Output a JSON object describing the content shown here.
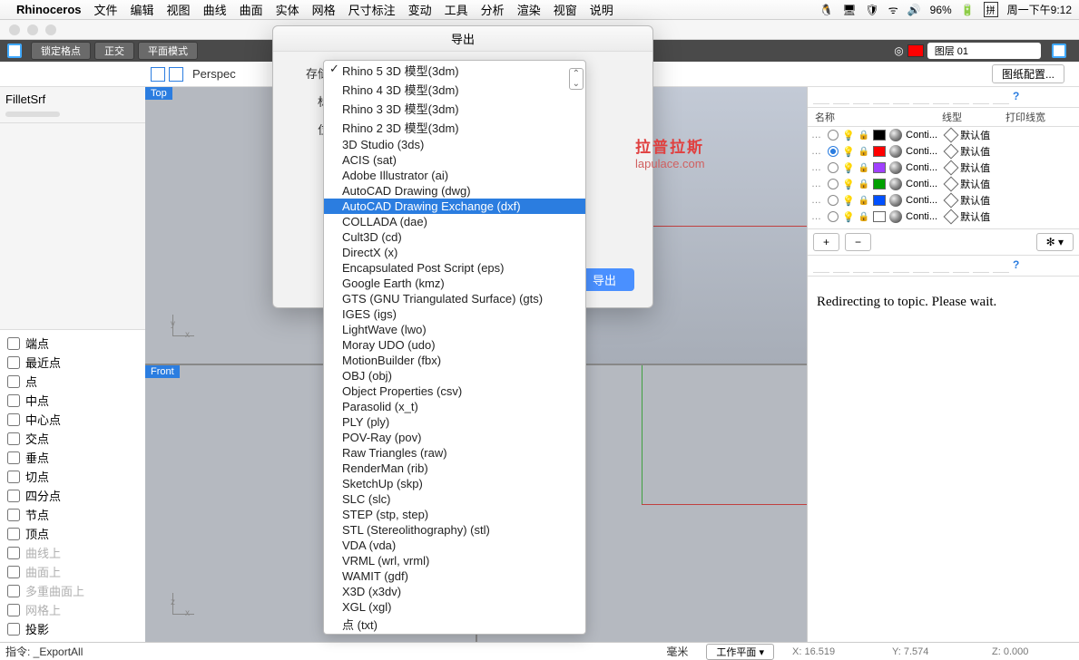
{
  "menubar": {
    "app": "Rhinoceros",
    "items": [
      "文件",
      "编辑",
      "视图",
      "曲线",
      "曲面",
      "实体",
      "网格",
      "尺寸标注",
      "变动",
      "工具",
      "分析",
      "渲染",
      "视窗",
      "说明"
    ],
    "battery": "96%",
    "ime": "拼",
    "clock": "周一下午9:12"
  },
  "toolbar": {
    "lock": "锁定格点",
    "ortho": "正交",
    "planar": "平面模式",
    "layer_label": "图层 01"
  },
  "subtoolbar": {
    "persp": "Perspec",
    "sheetcfg": "图纸配置..."
  },
  "left": {
    "cmd": "FilletSrf",
    "osnap": [
      {
        "label": "端点",
        "on": false,
        "dim": false
      },
      {
        "label": "最近点",
        "on": false,
        "dim": false
      },
      {
        "label": "点",
        "on": false,
        "dim": false
      },
      {
        "label": "中点",
        "on": false,
        "dim": false
      },
      {
        "label": "中心点",
        "on": false,
        "dim": false
      },
      {
        "label": "交点",
        "on": false,
        "dim": false
      },
      {
        "label": "垂点",
        "on": false,
        "dim": false
      },
      {
        "label": "切点",
        "on": false,
        "dim": false
      },
      {
        "label": "四分点",
        "on": false,
        "dim": false
      },
      {
        "label": "节点",
        "on": false,
        "dim": false
      },
      {
        "label": "顶点",
        "on": false,
        "dim": false
      },
      {
        "label": "曲线上",
        "on": false,
        "dim": true
      },
      {
        "label": "曲面上",
        "on": false,
        "dim": true
      },
      {
        "label": "多重曲面上",
        "on": false,
        "dim": true
      },
      {
        "label": "网格上",
        "on": false,
        "dim": true
      },
      {
        "label": "投影",
        "on": false,
        "dim": false
      }
    ]
  },
  "views": {
    "top": "Top",
    "front": "Front"
  },
  "right": {
    "hdr": {
      "name": "名称",
      "ltype": "线型",
      "pwidth": "打印线宽"
    },
    "layers": [
      {
        "on": false,
        "color": "#000000",
        "txt": "Conti...",
        "def": "默认值"
      },
      {
        "on": true,
        "color": "#ff0000",
        "txt": "Conti...",
        "def": "默认值"
      },
      {
        "on": false,
        "color": "#a040ff",
        "txt": "Conti...",
        "def": "默认值"
      },
      {
        "on": false,
        "color": "#00a000",
        "txt": "Conti...",
        "def": "默认值"
      },
      {
        "on": false,
        "color": "#0050ff",
        "txt": "Conti...",
        "def": "默认值"
      },
      {
        "on": false,
        "color": "#ffffff",
        "txt": "Conti...",
        "def": "默认值"
      }
    ],
    "btns": {
      "add": "+",
      "del": "−",
      "gear": "✻ ▾"
    },
    "redirect": "Redirecting to topic. Please wait."
  },
  "dialog": {
    "title": "导出",
    "labels": {
      "save": "存储",
      "tag": "标",
      "pos": "位"
    },
    "export_btn": "导出",
    "sheet_btn": "图纸配置..."
  },
  "dropdown": {
    "selected_index": 8,
    "options": [
      "Rhino 5 3D 模型(3dm)",
      "Rhino 4 3D 模型(3dm)",
      "Rhino 3 3D 模型(3dm)",
      "Rhino 2 3D 模型(3dm)",
      "3D Studio (3ds)",
      "ACIS (sat)",
      "Adobe Illustrator (ai)",
      "AutoCAD Drawing (dwg)",
      "AutoCAD Drawing Exchange (dxf)",
      "COLLADA (dae)",
      "Cult3D (cd)",
      "DirectX (x)",
      "Encapsulated Post Script (eps)",
      "Google Earth (kmz)",
      "GTS (GNU Triangulated Surface) (gts)",
      "IGES (igs)",
      "LightWave (lwo)",
      "Moray UDO (udo)",
      "MotionBuilder (fbx)",
      "OBJ (obj)",
      "Object Properties (csv)",
      "Parasolid (x_t)",
      "PLY (ply)",
      "POV-Ray (pov)",
      "Raw Triangles (raw)",
      "RenderMan (rib)",
      "SketchUp (skp)",
      "SLC (slc)",
      "STEP (stp, step)",
      "STL (Stereolithography) (stl)",
      "VDA (vda)",
      "VRML (wrl, vrml)",
      "WAMIT (gdf)",
      "X3D (x3dv)",
      "XGL (xgl)",
      "点 (txt)"
    ]
  },
  "status": {
    "cmd": "指令: _ExportAll",
    "unit": "毫米",
    "plane": "工作平面 ▾",
    "x": "X: 16.519",
    "y": "Y: 7.574",
    "z": "Z: 0.000"
  },
  "watermark": {
    "big": "拉普拉斯",
    "small": "lapulace.com"
  }
}
